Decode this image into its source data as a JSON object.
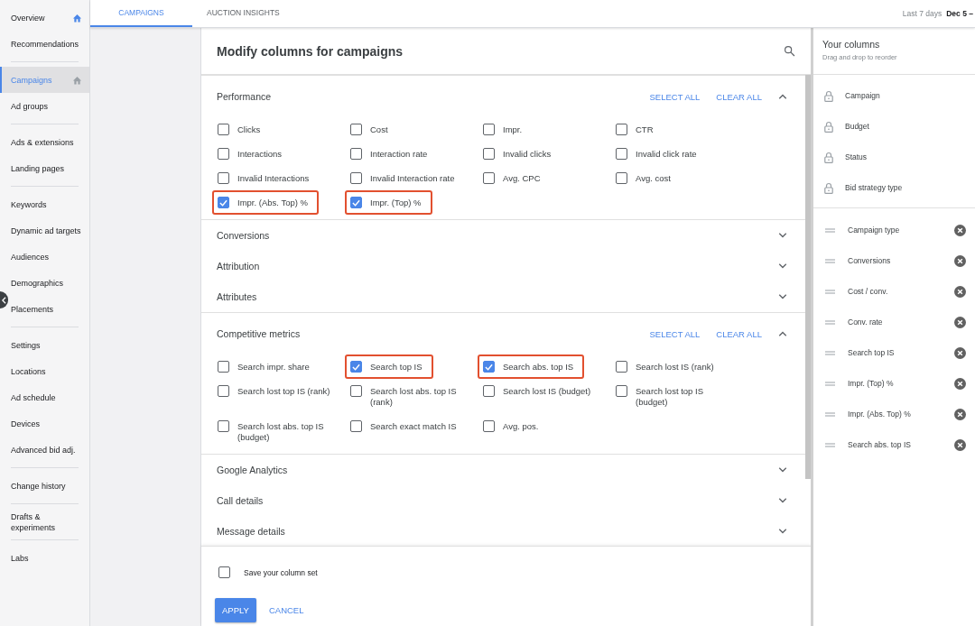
{
  "sidebar": {
    "groups": [
      [
        {
          "label": "Overview",
          "selected": false,
          "home_icon": true
        },
        {
          "label": "Recommendations",
          "selected": false,
          "home_icon": false
        }
      ],
      [
        {
          "label": "Campaigns",
          "selected": true,
          "home_icon": true
        },
        {
          "label": "Ad groups",
          "selected": false,
          "home_icon": false
        }
      ],
      [
        {
          "label": "Ads & extensions",
          "selected": false,
          "home_icon": false
        },
        {
          "label": "Landing pages",
          "selected": false,
          "home_icon": false
        }
      ],
      [
        {
          "label": "Keywords",
          "selected": false,
          "home_icon": false
        },
        {
          "label": "Dynamic ad targets",
          "selected": false,
          "home_icon": false
        },
        {
          "label": "Audiences",
          "selected": false,
          "home_icon": false
        },
        {
          "label": "Demographics",
          "selected": false,
          "home_icon": false
        },
        {
          "label": "Placements",
          "selected": false,
          "home_icon": false
        }
      ],
      [
        {
          "label": "Settings",
          "selected": false,
          "home_icon": false
        },
        {
          "label": "Locations",
          "selected": false,
          "home_icon": false
        },
        {
          "label": "Ad schedule",
          "selected": false,
          "home_icon": false
        },
        {
          "label": "Devices",
          "selected": false,
          "home_icon": false
        },
        {
          "label": "Advanced bid adj.",
          "selected": false,
          "home_icon": false
        }
      ],
      [
        {
          "label": "Change history",
          "selected": false,
          "home_icon": false
        }
      ],
      [
        {
          "label": "Drafts & experiments",
          "selected": false,
          "home_icon": false
        }
      ],
      [
        {
          "label": "Labs",
          "selected": false,
          "home_icon": false
        }
      ]
    ]
  },
  "tabs": [
    {
      "label": "CAMPAIGNS",
      "selected": true
    },
    {
      "label": "AUCTION INSIGHTS",
      "selected": false
    }
  ],
  "date_range": {
    "label": "Last 7 days",
    "value": "Dec 5 –"
  },
  "modal": {
    "title": "Modify columns for campaigns",
    "sections": [
      {
        "title": "Performance",
        "expanded": true,
        "select_all": "SELECT ALL",
        "clear_all": "CLEAR ALL",
        "options": [
          {
            "label": "Clicks",
            "checked": false,
            "highlighted": false
          },
          {
            "label": "Cost",
            "checked": false,
            "highlighted": false
          },
          {
            "label": "Impr.",
            "checked": false,
            "highlighted": false
          },
          {
            "label": "CTR",
            "checked": false,
            "highlighted": false
          },
          {
            "label": "Interactions",
            "checked": false,
            "highlighted": false
          },
          {
            "label": "Interaction rate",
            "checked": false,
            "highlighted": false
          },
          {
            "label": "Invalid clicks",
            "checked": false,
            "highlighted": false
          },
          {
            "label": "Invalid click rate",
            "checked": false,
            "highlighted": false
          },
          {
            "label": "Invalid Interactions",
            "checked": false,
            "highlighted": false
          },
          {
            "label": "Invalid Interaction rate",
            "checked": false,
            "highlighted": false
          },
          {
            "label": "Avg. CPC",
            "checked": false,
            "highlighted": false
          },
          {
            "label": "Avg. cost",
            "checked": false,
            "highlighted": false
          },
          {
            "label": "Impr. (Abs. Top) %",
            "checked": true,
            "highlighted": true
          },
          {
            "label": "Impr. (Top) %",
            "checked": true,
            "highlighted": true
          }
        ]
      },
      {
        "title": "Conversions",
        "expanded": false
      },
      {
        "title": "Attribution",
        "expanded": false
      },
      {
        "title": "Attributes",
        "expanded": false
      },
      {
        "title": "Competitive metrics",
        "expanded": true,
        "select_all": "SELECT ALL",
        "clear_all": "CLEAR ALL",
        "options": [
          {
            "label": "Search impr. share",
            "checked": false,
            "highlighted": false
          },
          {
            "label": "Search top IS",
            "checked": true,
            "highlighted": true
          },
          {
            "label": "Search abs. top IS",
            "checked": true,
            "highlighted": true
          },
          {
            "label": "Search lost IS (rank)",
            "checked": false,
            "highlighted": false
          },
          {
            "label": "Search lost top IS (rank)",
            "checked": false,
            "highlighted": false
          },
          {
            "label": "Search lost abs. top IS (rank)",
            "checked": false,
            "highlighted": false
          },
          {
            "label": "Search lost IS (budget)",
            "checked": false,
            "highlighted": false
          },
          {
            "label": "Search lost top IS (budget)",
            "checked": false,
            "highlighted": false
          },
          {
            "label": "Search lost abs. top IS (budget)",
            "checked": false,
            "highlighted": false
          },
          {
            "label": "Search exact match IS",
            "checked": false,
            "highlighted": false
          },
          {
            "label": "Avg. pos.",
            "checked": false,
            "highlighted": false
          }
        ]
      },
      {
        "title": "Google Analytics",
        "expanded": false
      },
      {
        "title": "Call details",
        "expanded": false
      },
      {
        "title": "Message details",
        "expanded": false
      }
    ],
    "save_option": {
      "label": "Save your column set",
      "checked": false
    },
    "apply": "APPLY",
    "cancel": "CANCEL"
  },
  "your_columns": {
    "title": "Your columns",
    "subtitle": "Drag and drop to reorder",
    "locked": [
      "Campaign",
      "Budget",
      "Status",
      "Bid strategy type"
    ],
    "removable": [
      "Campaign type",
      "Conversions",
      "Cost / conv.",
      "Conv. rate",
      "Search top IS",
      "Impr. (Top) %",
      "Impr. (Abs. Top) %",
      "Search abs. top IS"
    ]
  }
}
